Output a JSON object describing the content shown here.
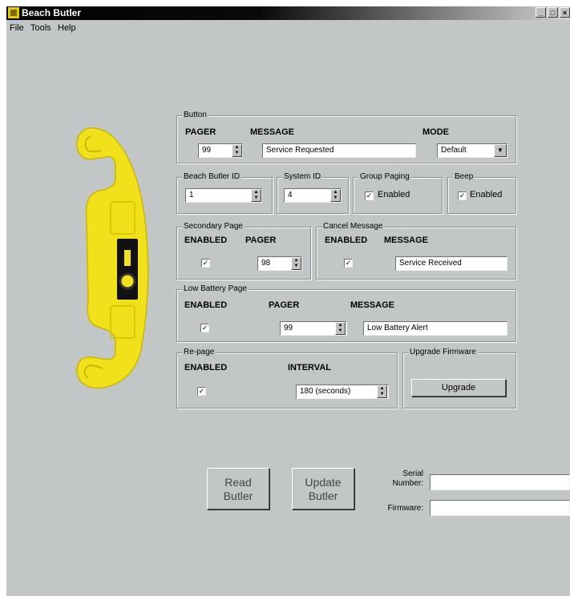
{
  "window": {
    "title": "Beach Butler",
    "controls": [
      "_",
      "□",
      "×"
    ]
  },
  "menu": [
    "File",
    "Tools",
    "Help"
  ],
  "button_group": {
    "title": "Button",
    "pager_label": "PAGER",
    "message_label": "MESSAGE",
    "mode_label": "MODE",
    "pager_value": "99",
    "message_value": "Service Requested",
    "mode_value": "Default"
  },
  "beach_butler_id": {
    "title": "Beach Butler ID",
    "value": "1"
  },
  "system_id": {
    "title": "System ID",
    "value": "4"
  },
  "group_paging": {
    "title": "Group Paging",
    "label": "Enabled",
    "checked": true
  },
  "beep": {
    "title": "Beep",
    "label": "Enabled",
    "checked": true
  },
  "secondary_page": {
    "title": "Secondary Page",
    "enabled_label": "ENABLED",
    "pager_label": "PAGER",
    "enabled": true,
    "pager_value": "98"
  },
  "cancel_message": {
    "title": "Cancel Message",
    "enabled_label": "ENABLED",
    "message_label": "MESSAGE",
    "enabled": true,
    "message_value": "Service Received"
  },
  "low_battery_page": {
    "title": "Low Battery Page",
    "enabled_label": "ENABLED",
    "pager_label": "PAGER",
    "message_label": "MESSAGE",
    "enabled": true,
    "pager_value": "99",
    "message_value": "Low Battery Alert"
  },
  "re_page": {
    "title": "Re-page",
    "enabled_label": "ENABLED",
    "interval_label": "INTERVAL",
    "enabled": true,
    "interval_value": "180 (seconds)"
  },
  "upgrade_firmware": {
    "title": "Upgrade Firmware",
    "button_label": "Upgrade"
  },
  "actions": {
    "read_line1": "Read",
    "read_line2": "Butler",
    "update_line1": "Update",
    "update_line2": "Butler"
  },
  "info": {
    "serial_line1": "Serial",
    "serial_line2": "Number:",
    "firmware_label": "Firmware:",
    "serial_value": "",
    "firmware_value": ""
  },
  "colors": {
    "device": "#f0e11a",
    "window_bg": "#c3c6c6"
  }
}
